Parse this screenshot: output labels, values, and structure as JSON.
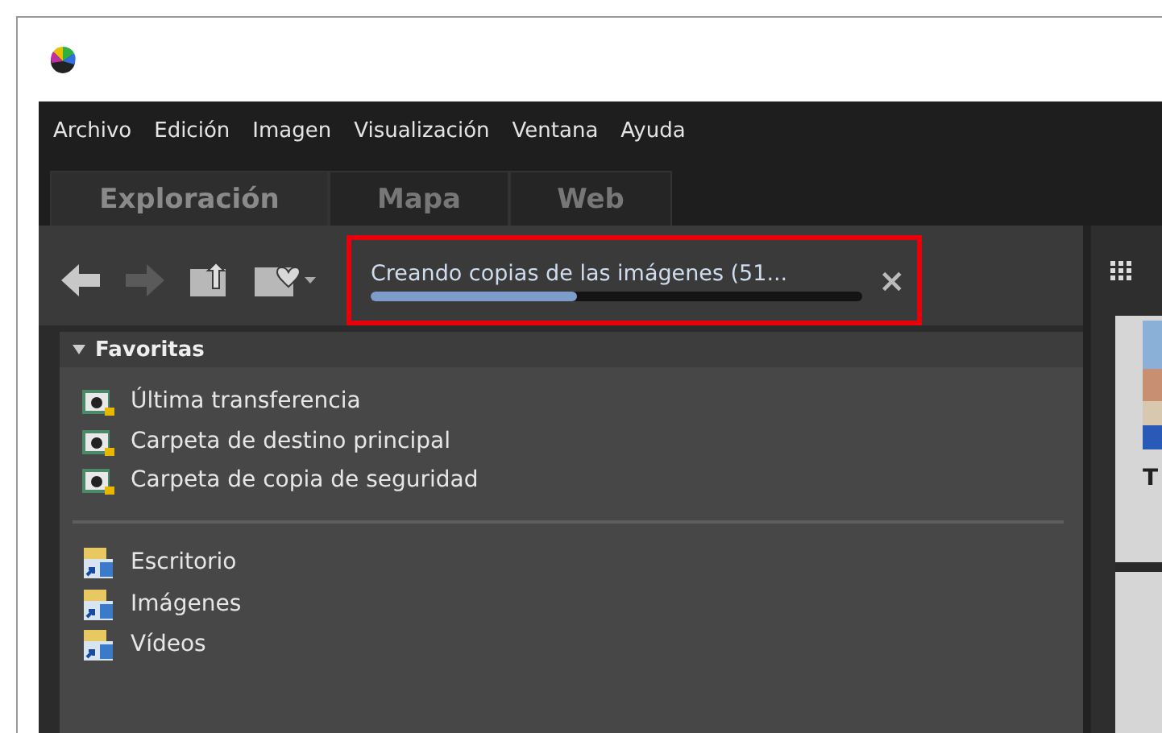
{
  "menu": [
    "Archivo",
    "Edición",
    "Imagen",
    "Visualización",
    "Ventana",
    "Ayuda"
  ],
  "tabs": [
    {
      "label": "Exploración",
      "selected": true
    },
    {
      "label": "Mapa",
      "selected": false
    },
    {
      "label": "Web",
      "selected": false
    }
  ],
  "progress": {
    "label": "Creando copias de las imágenes (51...",
    "level": 0.42,
    "close": "×"
  },
  "favorites": {
    "title": "Favoritas",
    "expanded": true,
    "items": [
      {
        "label": "Última transferencia",
        "kind": "camera"
      },
      {
        "label": "Carpeta de destino principal",
        "kind": "camera"
      },
      {
        "label": "Carpeta de copia de seguridad",
        "kind": "camera"
      }
    ]
  },
  "folders": [
    {
      "label": "Escritorio",
      "kind": "folder"
    },
    {
      "label": "Imágenes",
      "kind": "folder"
    },
    {
      "label": "Vídeos",
      "kind": "folder"
    }
  ],
  "thumbnails": [
    {
      "caption": "T"
    }
  ]
}
